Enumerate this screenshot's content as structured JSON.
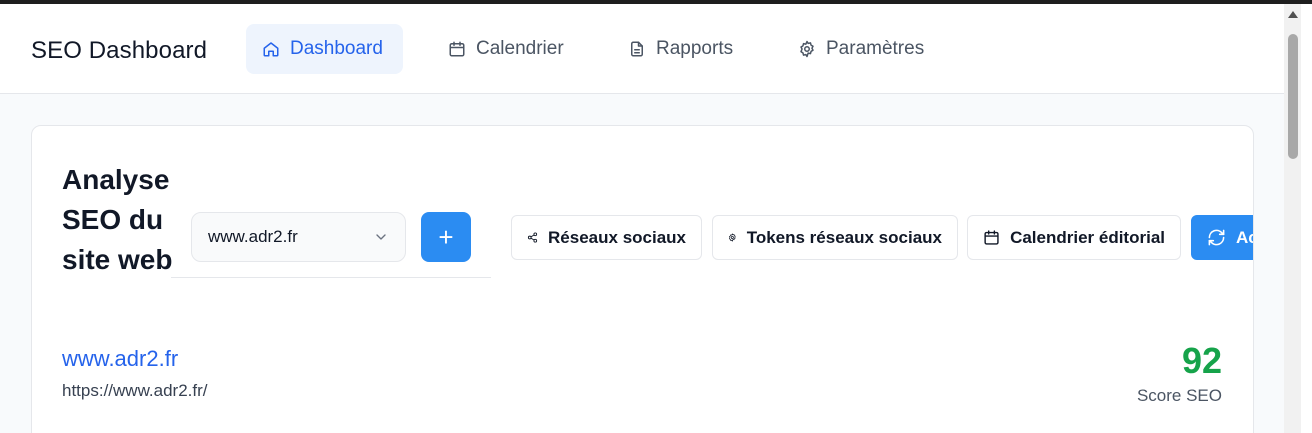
{
  "app": {
    "title": "SEO Dashboard"
  },
  "nav": {
    "items": [
      {
        "label": "Dashboard",
        "icon": "home-icon",
        "active": true
      },
      {
        "label": "Calendrier",
        "icon": "calendar-icon",
        "active": false
      },
      {
        "label": "Rapports",
        "icon": "file-text-icon",
        "active": false
      },
      {
        "label": "Paramètres",
        "icon": "gear-icon",
        "active": false
      }
    ]
  },
  "analysis": {
    "title": "Analyse SEO du site web",
    "site_select": {
      "value": "www.adr2.fr",
      "icon": "chevron-down-icon"
    },
    "add_button": {
      "label": "+",
      "icon": "plus-icon"
    },
    "actions": [
      {
        "label": "Réseaux sociaux",
        "icon": "share-icon"
      },
      {
        "label": "Tokens réseaux sociaux",
        "icon": "gear-icon"
      },
      {
        "label": "Calendrier éditorial",
        "icon": "calendar-icon"
      },
      {
        "label": "Actualiser",
        "icon": "refresh-icon"
      }
    ],
    "site": {
      "name": "www.adr2.fr",
      "url": "https://www.adr2.fr/"
    },
    "score": {
      "value": "92",
      "label": "Score SEO"
    }
  },
  "colors": {
    "accent": "#2b8cf2",
    "link": "#2563eb",
    "score": "#16a34a",
    "active_nav_bg": "#eef4fd"
  }
}
